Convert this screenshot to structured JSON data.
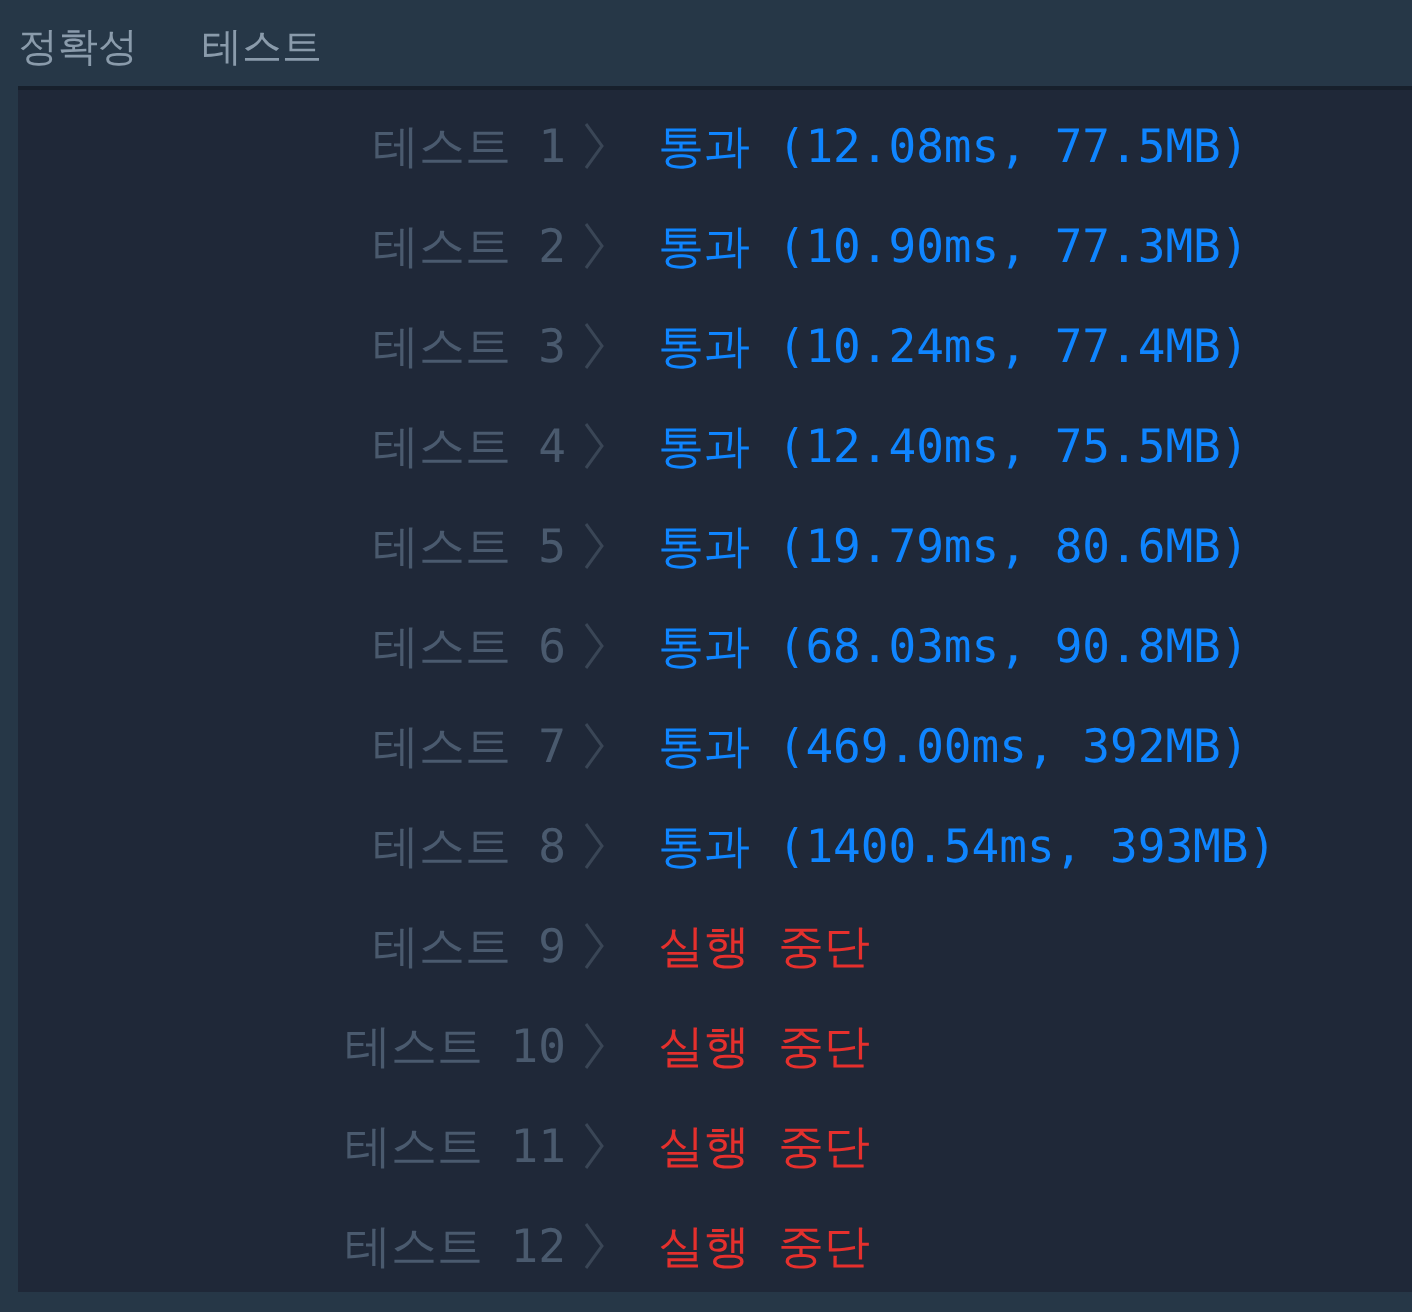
{
  "header": {
    "columns": [
      "정확성",
      "테스트"
    ]
  },
  "rows": [
    {
      "label": "테스트 1",
      "kind": "pass",
      "result": "통과 (12.08ms, 77.5MB)"
    },
    {
      "label": "테스트 2",
      "kind": "pass",
      "result": "통과 (10.90ms, 77.3MB)"
    },
    {
      "label": "테스트 3",
      "kind": "pass",
      "result": "통과 (10.24ms, 77.4MB)"
    },
    {
      "label": "테스트 4",
      "kind": "pass",
      "result": "통과 (12.40ms, 75.5MB)"
    },
    {
      "label": "테스트 5",
      "kind": "pass",
      "result": "통과 (19.79ms, 80.6MB)"
    },
    {
      "label": "테스트 6",
      "kind": "pass",
      "result": "통과 (68.03ms, 90.8MB)"
    },
    {
      "label": "테스트 7",
      "kind": "pass",
      "result": "통과 (469.00ms, 392MB)"
    },
    {
      "label": "테스트 8",
      "kind": "pass",
      "result": "통과 (1400.54ms, 393MB)"
    },
    {
      "label": "테스트 9",
      "kind": "fail",
      "result": "실행 중단"
    },
    {
      "label": "테스트 10",
      "kind": "fail",
      "result": "실행 중단"
    },
    {
      "label": "테스트 11",
      "kind": "fail",
      "result": "실행 중단"
    },
    {
      "label": "테스트 12",
      "kind": "fail",
      "result": "실행 중단"
    }
  ]
}
